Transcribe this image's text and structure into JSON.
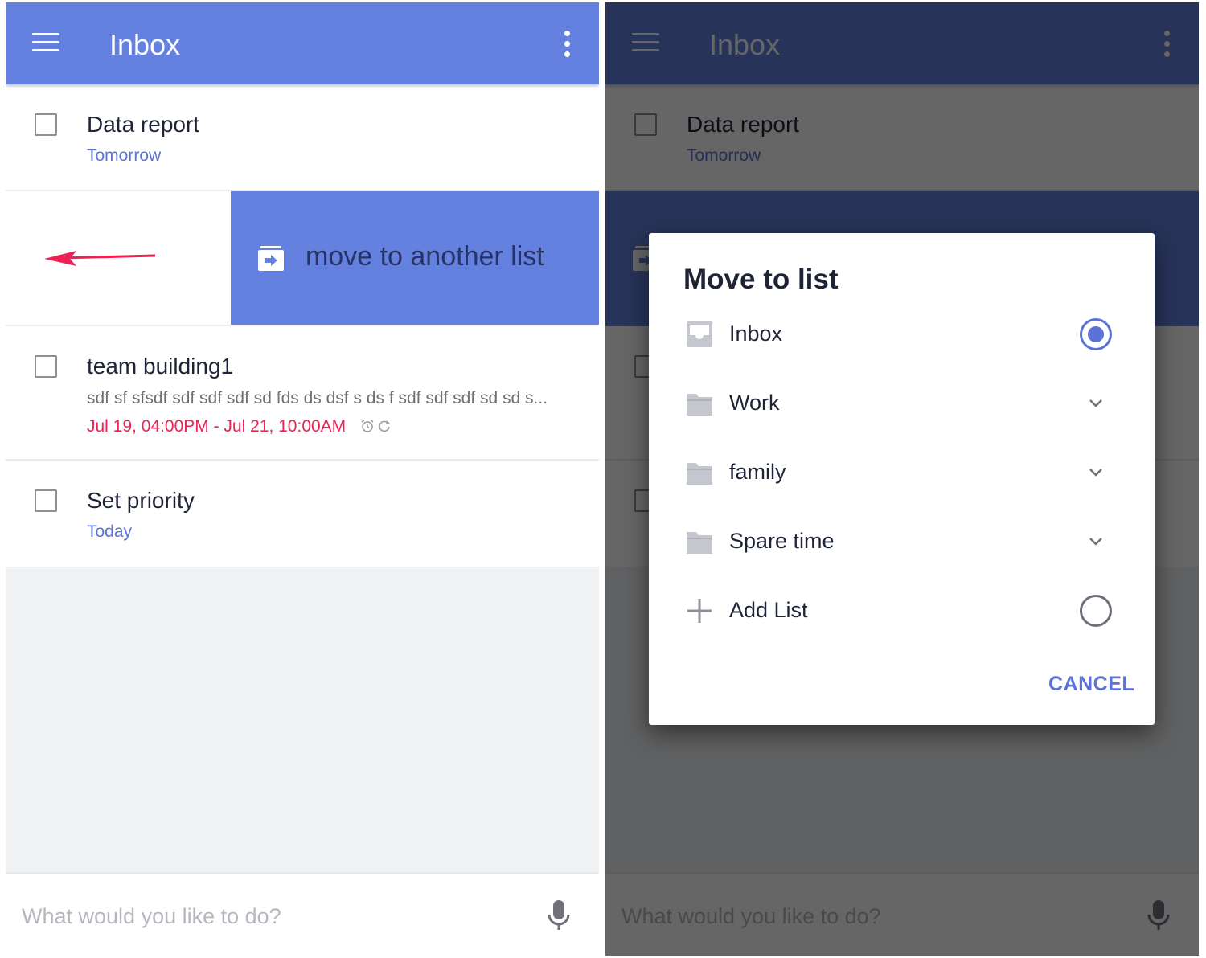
{
  "app": {
    "title": "Inbox",
    "accent_color": "#6581df",
    "due_color": "#5b72d6",
    "overdue_color": "#ee2155"
  },
  "tasks": [
    {
      "title": "Data report",
      "due": "Tomorrow"
    },
    {
      "title": "team building1",
      "note": "sdf sf sfsdf sdf sdf sdf sd fds ds dsf s ds f sdf sdf sdf sd sd s...",
      "due": "Jul 19, 04:00PM - Jul 21, 10:00AM",
      "icons": [
        "alarm-icon",
        "repeat-icon"
      ]
    },
    {
      "title": "Set priority",
      "due": "Today"
    }
  ],
  "swipe": {
    "action_label": "move to another list",
    "action_icon": "move-to-list-icon",
    "gesture_icon": "swipe-left-arrow-icon"
  },
  "composer": {
    "placeholder": "What would you like to do?",
    "icon": "mic-icon"
  },
  "dialog": {
    "title": "Move to list",
    "options": [
      {
        "label": "Inbox",
        "icon": "inbox-icon",
        "trailing": "radio-selected"
      },
      {
        "label": "Work",
        "icon": "folder-icon",
        "trailing": "chevron-down"
      },
      {
        "label": "family",
        "icon": "folder-icon",
        "trailing": "chevron-down"
      },
      {
        "label": "Spare time",
        "icon": "folder-icon",
        "trailing": "chevron-down"
      },
      {
        "label": "Add List",
        "icon": "plus-icon",
        "trailing": "radio-empty"
      }
    ],
    "cancel_label": "CANCEL"
  }
}
